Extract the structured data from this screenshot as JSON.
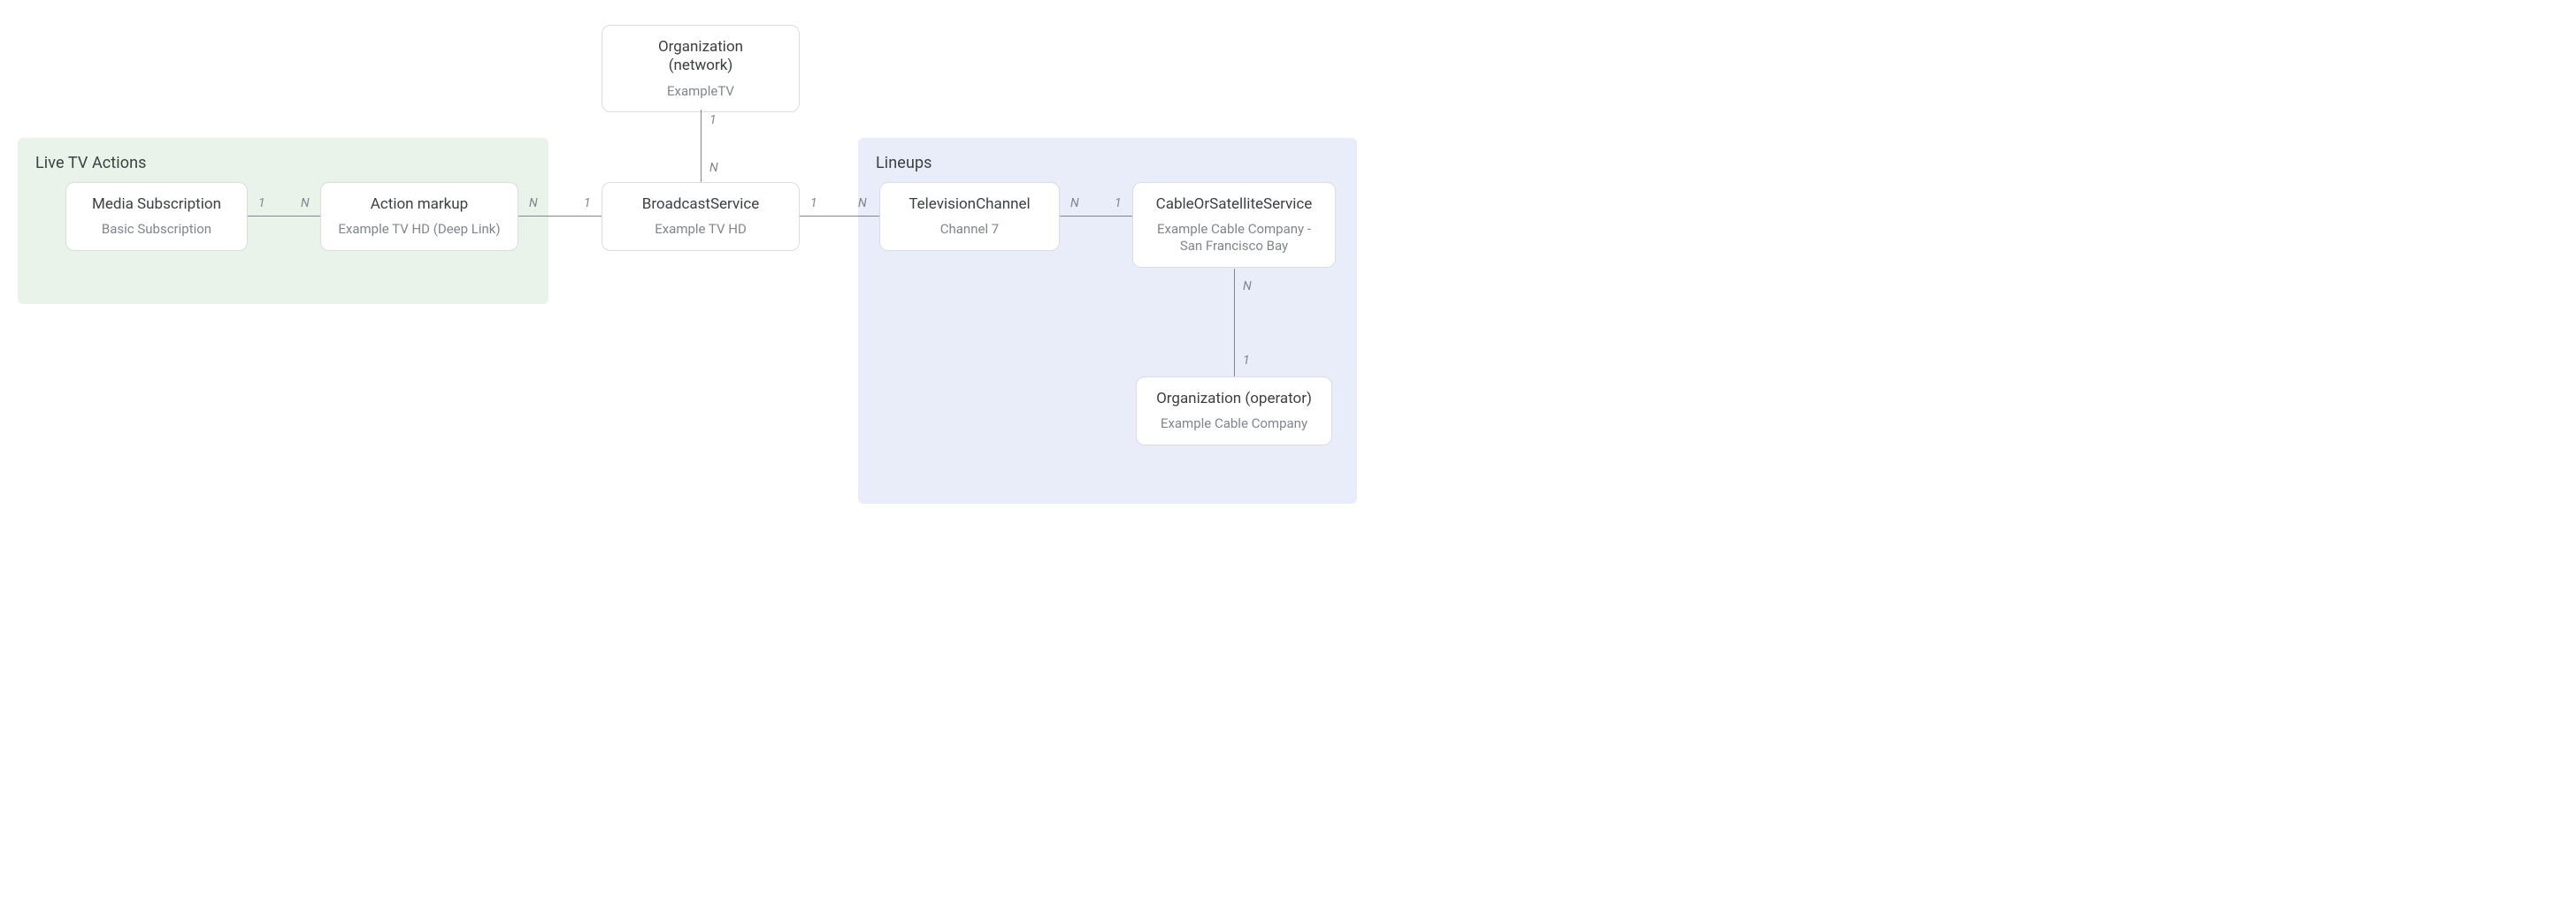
{
  "groups": {
    "live_tv": {
      "title": "Live TV Actions"
    },
    "lineups": {
      "title": "Lineups"
    }
  },
  "nodes": {
    "org_network": {
      "title": "Organization\n(network)",
      "subtitle": "ExampleTV"
    },
    "media_subscription": {
      "title": "Media Subscription",
      "subtitle": "Basic Subscription"
    },
    "action_markup": {
      "title": "Action markup",
      "subtitle": "Example TV HD (Deep Link)"
    },
    "broadcast_service": {
      "title": "BroadcastService",
      "subtitle": "Example TV HD"
    },
    "television_channel": {
      "title": "TelevisionChannel",
      "subtitle": "Channel 7"
    },
    "cable_sat_service": {
      "title": "CableOrSatelliteService",
      "subtitle": "Example Cable Company - San Francisco Bay"
    },
    "org_operator": {
      "title": "Organization (operator)",
      "subtitle": "Example Cable Company"
    }
  },
  "cardinality": {
    "one": "1",
    "many": "N"
  }
}
